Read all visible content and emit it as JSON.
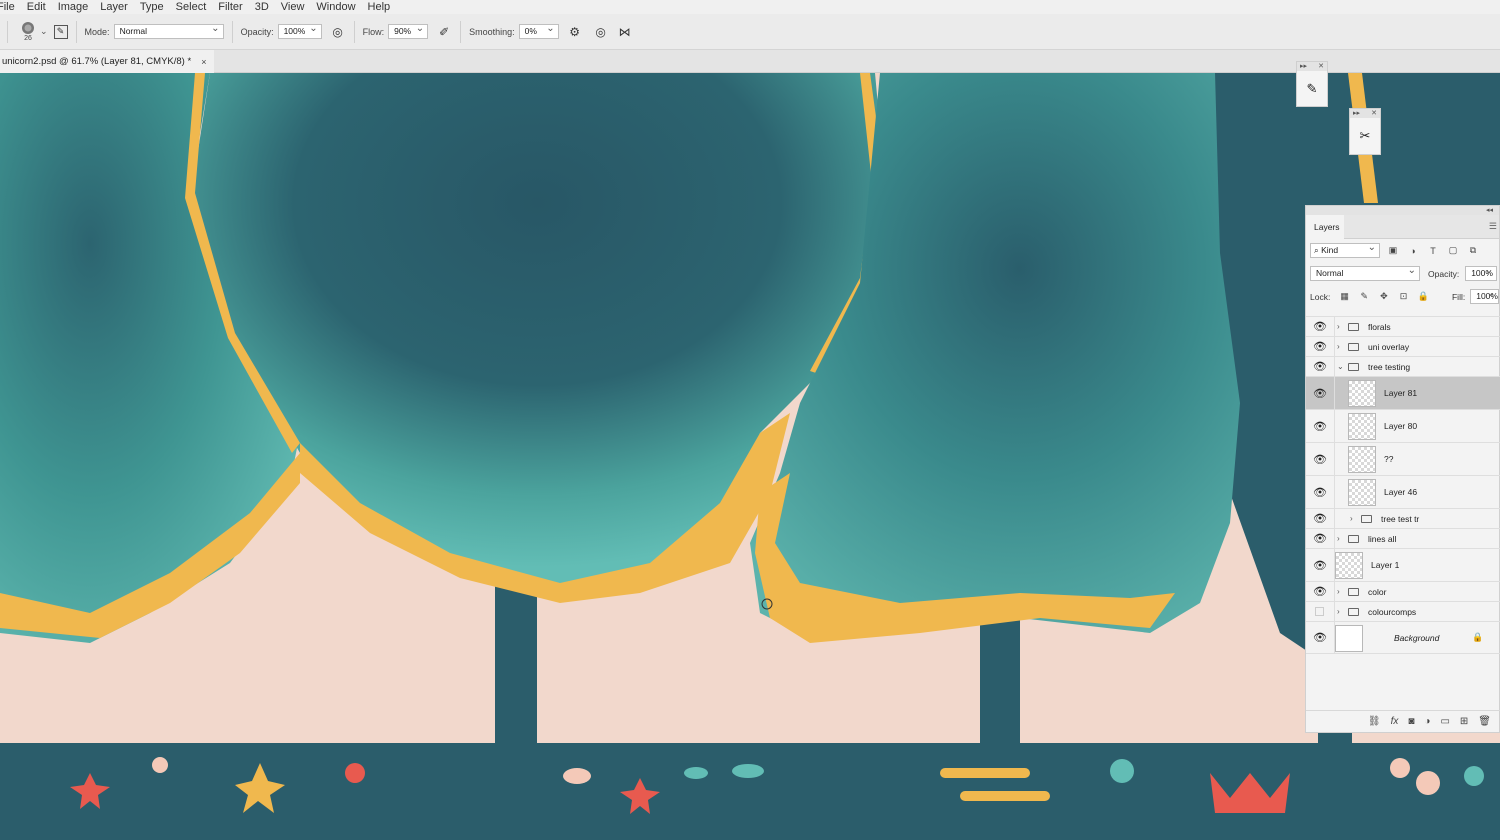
{
  "menu": [
    "File",
    "Edit",
    "Image",
    "Layer",
    "Type",
    "Select",
    "Filter",
    "3D",
    "View",
    "Window",
    "Help"
  ],
  "options": {
    "brush_size": "26",
    "mode_label": "Mode:",
    "mode_value": "Normal",
    "opacity_label": "Opacity:",
    "opacity_value": "100%",
    "flow_label": "Flow:",
    "flow_value": "90%",
    "smoothing_label": "Smoothing:",
    "smoothing_value": "0%"
  },
  "document": {
    "tab_title": "unicorn2.psd @ 61.7% (Layer 81, CMYK/8) *",
    "close": "×"
  },
  "floating_panels": {
    "brush_panel_icon": "brush-settings-icon",
    "clone_panel_icon": "clone-source-icon"
  },
  "layers_panel": {
    "tab": "Layers",
    "filter_kind": "Kind",
    "blend_mode": "Normal",
    "opacity_label": "Opacity:",
    "opacity_value": "100%",
    "lock_label": "Lock:",
    "fill_label": "Fill:",
    "fill_value": "100%",
    "layers": [
      {
        "name": "florals",
        "type": "group",
        "visible": true,
        "indent": 0,
        "expanded": false
      },
      {
        "name": "uni overlay",
        "type": "group",
        "visible": true,
        "indent": 0,
        "expanded": false
      },
      {
        "name": "tree testing",
        "type": "group",
        "visible": true,
        "indent": 0,
        "expanded": true
      },
      {
        "name": "Layer 81",
        "type": "layer",
        "visible": true,
        "indent": 1,
        "selected": true
      },
      {
        "name": "Layer 80",
        "type": "layer",
        "visible": true,
        "indent": 1
      },
      {
        "name": "??",
        "type": "layer",
        "visible": true,
        "indent": 1
      },
      {
        "name": "Layer 46",
        "type": "layer",
        "visible": true,
        "indent": 1
      },
      {
        "name": "tree test tr",
        "type": "group",
        "visible": true,
        "indent": 1,
        "expanded": false
      },
      {
        "name": "lines all",
        "type": "group",
        "visible": true,
        "indent": 0,
        "expanded": false
      },
      {
        "name": "Layer 1",
        "type": "layer",
        "visible": true,
        "indent": 0
      },
      {
        "name": "color",
        "type": "group",
        "visible": true,
        "indent": 0,
        "expanded": false
      },
      {
        "name": "colourcomps",
        "type": "group",
        "visible": false,
        "indent": 0,
        "expanded": false
      },
      {
        "name": "Background",
        "type": "background",
        "visible": true,
        "indent": 0,
        "locked": true
      }
    ]
  },
  "colors": {
    "teal_dark": "#2b5b6b",
    "teal_mid": "#3a8a8c",
    "teal_light": "#62bdb5",
    "mustard": "#f0b84e",
    "blush": "#f2d8cc",
    "coral": "#e85a4f",
    "selection": "#c6c6c6"
  }
}
